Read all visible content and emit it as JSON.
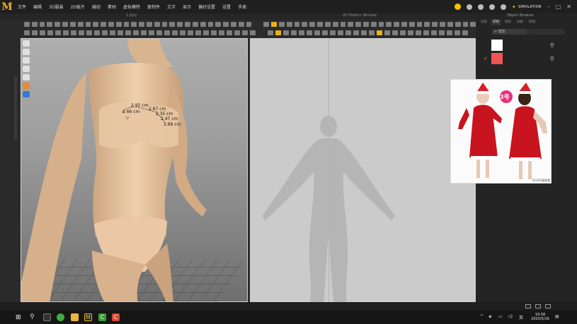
{
  "app": {
    "logo_text": "M",
    "menu": [
      "文件",
      "编辑",
      "3D服装",
      "2D板片",
      "缝纫",
      "素材",
      "虚拟模特",
      "复制件",
      "文字",
      "显示",
      "偏好设置",
      "设置",
      "手册"
    ],
    "simulation_label": "SIMULATION",
    "window_controls": [
      "–",
      "□",
      "✕"
    ]
  },
  "windows": {
    "viewport3d_title": "1.Zprj",
    "pattern_title": "2D Pattern Window",
    "object_browser_title": "Object Browser"
  },
  "viewport": {
    "measurements": [
      {
        "text": "2.95 cm"
      },
      {
        "text": "2.66 cm"
      },
      {
        "text": "2.87 cm"
      },
      {
        "text": "2.35 cm"
      },
      {
        "text": "2.47 cm"
      },
      {
        "text": "2.89 cm"
      }
    ]
  },
  "object_browser": {
    "tabs": [
      "场景",
      "织物",
      "纽扣",
      "扣眼",
      "明线"
    ],
    "add_button": "+ 增加",
    "items": [
      {
        "color": "#ffffff",
        "checked": false
      },
      {
        "color": "#f05454",
        "checked": true
      }
    ]
  },
  "reference_image": {
    "badge": "3号",
    "watermark": "1019号服装素"
  },
  "taskbar": {
    "time": "16:58",
    "date": "2020/5/16",
    "lang": "英"
  },
  "colors": {
    "accent": "#f2b21a",
    "pattern_bg": "#cbcbcb"
  }
}
